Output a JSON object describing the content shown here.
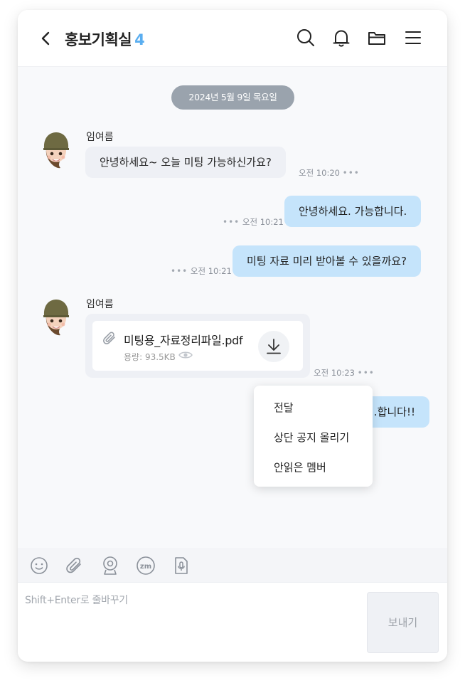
{
  "header": {
    "title": "홍보기획실",
    "member_count": "4"
  },
  "chat": {
    "date_label": "2024년 5월 9일 목요일",
    "messages": [
      {
        "sender": "임여름",
        "text": "안녕하세요~ 오늘 미팅 가능하신가요?",
        "time": "오전 10:20",
        "direction": "in"
      },
      {
        "text": "안녕하세요. 가능합니다.",
        "time": "오전 10:21",
        "direction": "out"
      },
      {
        "text": "미팅 자료 미리 받아볼 수 있을까요?",
        "time": "오전 10:21",
        "direction": "out"
      },
      {
        "sender": "임여름",
        "file_name": "미팅용_자료정리파일.pdf",
        "file_size": "용량: 93.5KB",
        "time": "오전 10:23",
        "direction": "in"
      },
      {
        "text": "…합니다!!",
        "direction": "out"
      }
    ],
    "more_dots": "•••"
  },
  "context_menu": {
    "items": [
      "전달",
      "상단 공지 올리기",
      "안읽은 멤버"
    ]
  },
  "composer": {
    "placeholder": "Shift+Enter로 줄바꾸기",
    "send_label": "보내기"
  },
  "colors": {
    "accent": "#5aaef0",
    "outgoing_bubble": "#c5e4fb",
    "incoming_bubble": "#eef0f5",
    "date_pill": "#9aa3ad"
  },
  "icons": {
    "header": [
      "back-arrow-icon",
      "search-icon",
      "bell-icon",
      "folder-icon",
      "menu-icon"
    ],
    "toolbar": [
      "emoji-icon",
      "attach-icon",
      "webcam-icon",
      "zoom-icon",
      "voice-file-icon"
    ]
  }
}
